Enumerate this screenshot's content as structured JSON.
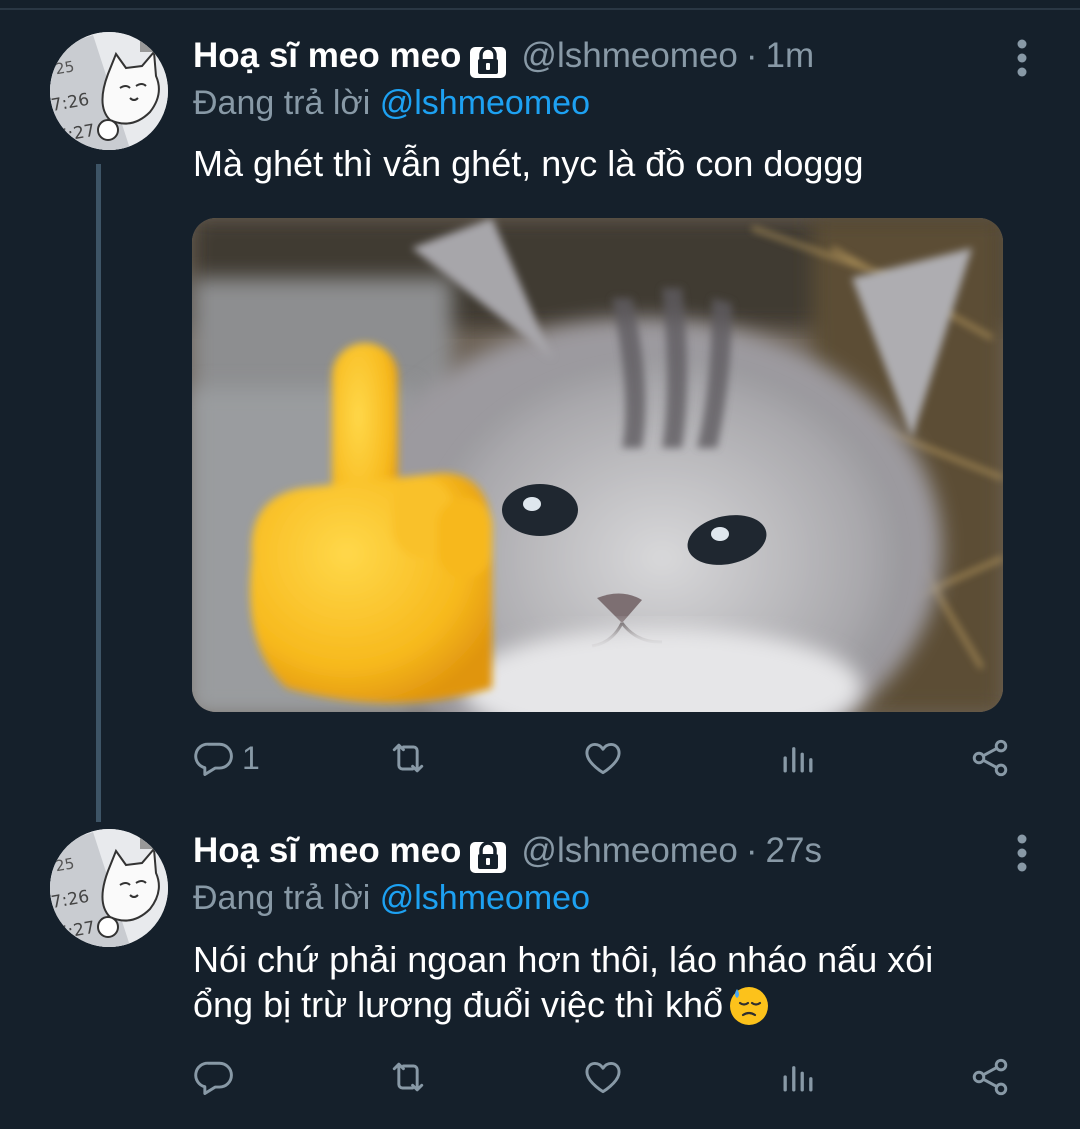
{
  "tweets": [
    {
      "author_name": "Hoạ sĩ meo meo",
      "handle": "@lshmeomeo",
      "separator": "·",
      "time": "1m",
      "reply_prefix": "Đang trả lời",
      "reply_to": "@lshmeomeo",
      "text": "Mà ghét thì vẫn ghét, nyc là đồ con doggg",
      "has_media": true,
      "reply_count": "1"
    },
    {
      "author_name": "Hoạ sĩ meo meo",
      "handle": "@lshmeomeo",
      "separator": "·",
      "time": "27s",
      "reply_prefix": "Đang trả lời",
      "reply_to": "@lshmeomeo",
      "text_line1": "Nói chứ phải ngoan hơn thôi, láo nháo nấu xói",
      "text_line2": "ổng bị trừ lương đuổi việc thì khổ",
      "reply_count": ""
    }
  ],
  "avatar_clock_texts": [
    "25",
    "7:26",
    "7:27"
  ],
  "icons": {
    "lock": "lock-icon",
    "more": "more-vertical-icon",
    "reply": "reply-icon",
    "retweet": "retweet-icon",
    "like": "heart-icon",
    "stats": "analytics-icon",
    "share": "share-icon",
    "emoji": "downcast-face-with-sweat-emoji"
  },
  "colors": {
    "background": "#15202b",
    "text_primary": "#ffffff",
    "text_secondary": "#8899a6",
    "accent": "#1da1f2",
    "thread_line": "#3d5466"
  }
}
